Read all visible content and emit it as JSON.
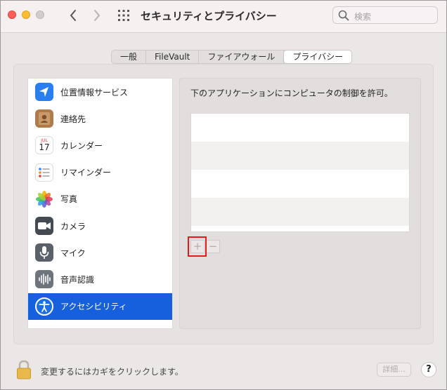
{
  "window": {
    "title": "セキュリティとプライバシー"
  },
  "search": {
    "placeholder": "検索",
    "icon": "search-icon"
  },
  "tabs": [
    {
      "label": "一般"
    },
    {
      "label": "FileVault"
    },
    {
      "label": "ファイアウォール"
    },
    {
      "label": "プライバシー",
      "active": true
    }
  ],
  "sidebar": {
    "items": [
      {
        "label": "位置情報サービス",
        "icon": "location-arrow-icon"
      },
      {
        "label": "連絡先",
        "icon": "contacts-icon"
      },
      {
        "label": "カレンダー",
        "icon": "calendar-icon",
        "icon_month": "JUL",
        "icon_day": "17"
      },
      {
        "label": "リマインダー",
        "icon": "reminders-icon"
      },
      {
        "label": "写真",
        "icon": "photos-icon"
      },
      {
        "label": "カメラ",
        "icon": "camera-icon"
      },
      {
        "label": "マイク",
        "icon": "microphone-icon"
      },
      {
        "label": "音声認識",
        "icon": "speech-recognition-icon"
      },
      {
        "label": "アクセシビリティ",
        "icon": "accessibility-icon",
        "selected": true
      }
    ]
  },
  "main": {
    "instruction": "下のアプリケーションにコンピュータの制御を許可。",
    "add_label": "+",
    "remove_label": "−"
  },
  "footer": {
    "lock_text": "変更するにはカギをクリックします。",
    "details_label": "詳細...",
    "help_label": "?"
  },
  "colors": {
    "selection": "#1760dd",
    "highlight": "#e81919"
  }
}
